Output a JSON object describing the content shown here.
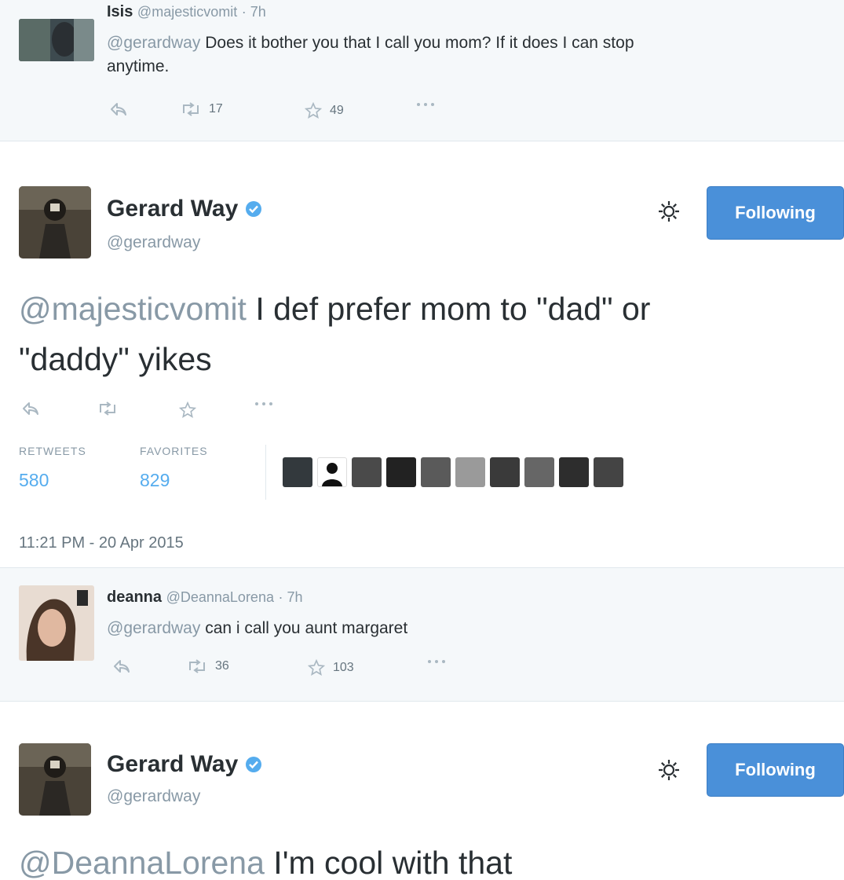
{
  "replies": [
    {
      "name": "Isis",
      "handle": "@majesticvomit",
      "time": "· 7h",
      "mention": "@gerardway",
      "text": "Does it bother you that I call you mom? If it does I can stop",
      "text_cont": "anytime.",
      "retweets": "17",
      "favorites": "49"
    },
    {
      "name": "deanna",
      "handle": "@DeannaLorena",
      "time": "· 7h",
      "mention": "@gerardway",
      "text": "can i call you aunt margaret",
      "retweets": "36",
      "favorites": "103"
    }
  ],
  "tweets": [
    {
      "name": "Gerard Way",
      "handle": "@gerardway",
      "follow_label": "Following",
      "mention": "@majesticvomit",
      "text_line1": " I def prefer mom to \"dad\" or",
      "text_line2": "\"daddy\" yikes",
      "retweets_label": "RETWEETS",
      "retweets": "580",
      "favorites_label": "FAVORITES",
      "favorites": "829",
      "timestamp": "11:21 PM - 20 Apr 2015"
    },
    {
      "name": "Gerard Way",
      "handle": "@gerardway",
      "follow_label": "Following",
      "mention": "@DeannaLorena",
      "text": " I'm cool with that"
    }
  ],
  "icons": {
    "reply": "reply-icon",
    "retweet": "retweet-icon",
    "favorite": "star-icon",
    "more": "more-icon",
    "gear": "gear-icon",
    "verified": "verified-badge-icon"
  },
  "colors": {
    "link_gray": "#8899a6",
    "follow_button": "#4a90d9",
    "stat_number": "#55acee",
    "reply_bg": "#f5f8fa"
  }
}
